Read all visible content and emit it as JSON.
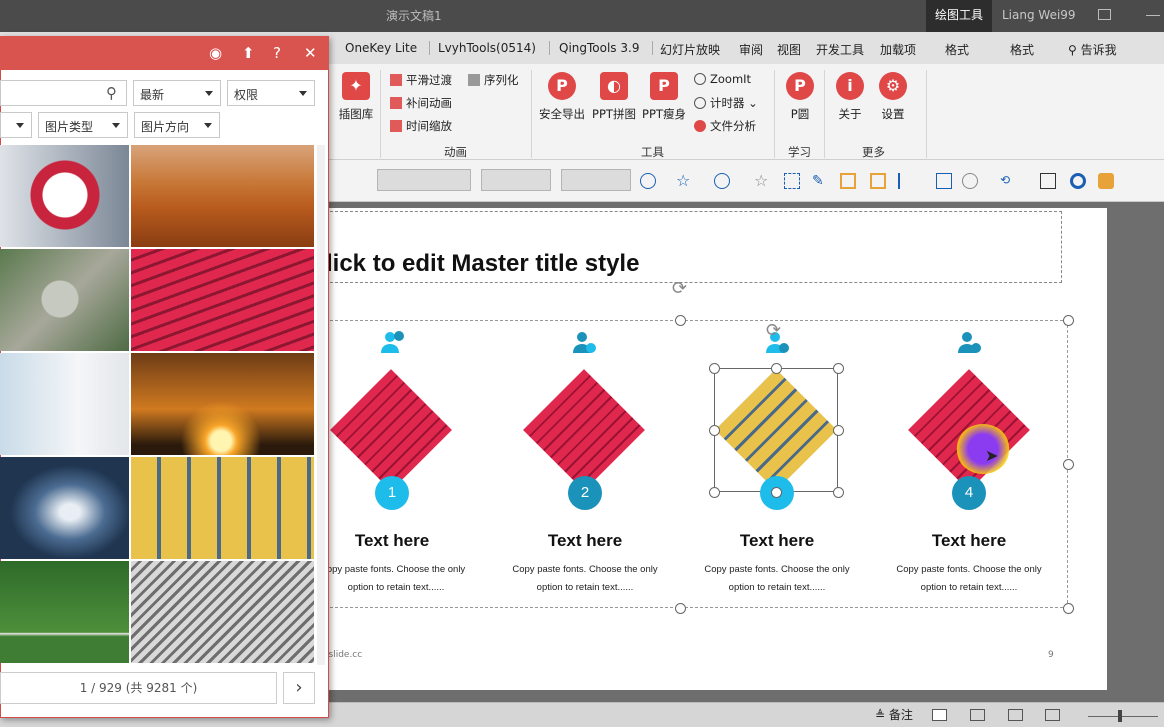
{
  "app": {
    "doc_title": "演示文稿1",
    "context_tab": "绘图工具",
    "user": "Liang Wei99"
  },
  "ribbon_tabs": [
    "OneKey Lite",
    "LvyhTools(0514)",
    "QingTools 3.9",
    "幻灯片放映",
    "审阅",
    "视图",
    "开发工具",
    "加载项",
    "格式",
    "格式"
  ],
  "tell_me": "告诉我",
  "ribbon": {
    "insert_lib": "插图库",
    "anim_items": [
      "平滑过渡",
      "补间动画",
      "时间缩放"
    ],
    "serialize": "序列化",
    "anim_group": "动画",
    "tools": [
      "安全导出",
      "PPT拼图",
      "PPT瘦身"
    ],
    "zoomit": "ZoomIt",
    "timer": "计时器",
    "file_analysis": "文件分析",
    "tools_group": "工具",
    "p_circle": "P圆",
    "learn_group": "学习",
    "about": "关于",
    "settings": "设置",
    "more_group": "更多"
  },
  "slide": {
    "title": "lick to edit Master title style",
    "footer": "islide.cc",
    "page": "9",
    "columns": [
      {
        "num": "1",
        "head": "Text here",
        "body1": "opy paste fonts. Choose the only",
        "body2": "option to retain text......",
        "color": "#1ebcea"
      },
      {
        "num": "2",
        "head": "Text here",
        "body1": "Copy paste fonts. Choose the only",
        "body2": "option to retain text......",
        "color": "#1b92b9"
      },
      {
        "num": "",
        "head": "Text here",
        "body1": "Copy paste fonts. Choose the only",
        "body2": "option to retain text......",
        "color": "#1ebcea"
      },
      {
        "num": "4",
        "head": "Text here",
        "body1": "Copy paste fonts. Choose the only",
        "body2": "option to retain text......",
        "color": "#1b92b9"
      }
    ]
  },
  "panel": {
    "sort": "最新",
    "license": "权限",
    "img_type": "图片类型",
    "img_dir": "图片方向",
    "pager": "1 / 929 (共 9281 个)",
    "next": "›"
  },
  "status": {
    "notes": "备注"
  },
  "colors": {
    "panel_red": "#d9534f",
    "teal_dark": "#1b92b9",
    "teal_light": "#1ebcea"
  }
}
